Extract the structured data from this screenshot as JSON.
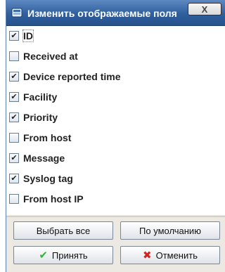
{
  "window": {
    "title": "Изменить отображаемые поля",
    "close_label": "X"
  },
  "options": [
    {
      "label": "ID",
      "checked": true
    },
    {
      "label": "Received at",
      "checked": false
    },
    {
      "label": "Device reported time",
      "checked": true
    },
    {
      "label": "Facility",
      "checked": true
    },
    {
      "label": "Priority",
      "checked": true
    },
    {
      "label": "From host",
      "checked": false
    },
    {
      "label": "Message",
      "checked": true
    },
    {
      "label": "Syslog tag",
      "checked": true
    },
    {
      "label": "From host IP",
      "checked": false
    }
  ],
  "buttons": {
    "select_all": "Выбрать все",
    "default": "По умолчанию",
    "accept": "Принять",
    "cancel": "Отменить"
  },
  "icons": {
    "check": "✔",
    "accept_icon": "checkmark-icon",
    "cancel_icon": "red-x-icon"
  },
  "colors": {
    "titlebar": "#2f5f9e",
    "accept_green": "#38b23a",
    "cancel_red": "#d62222"
  }
}
